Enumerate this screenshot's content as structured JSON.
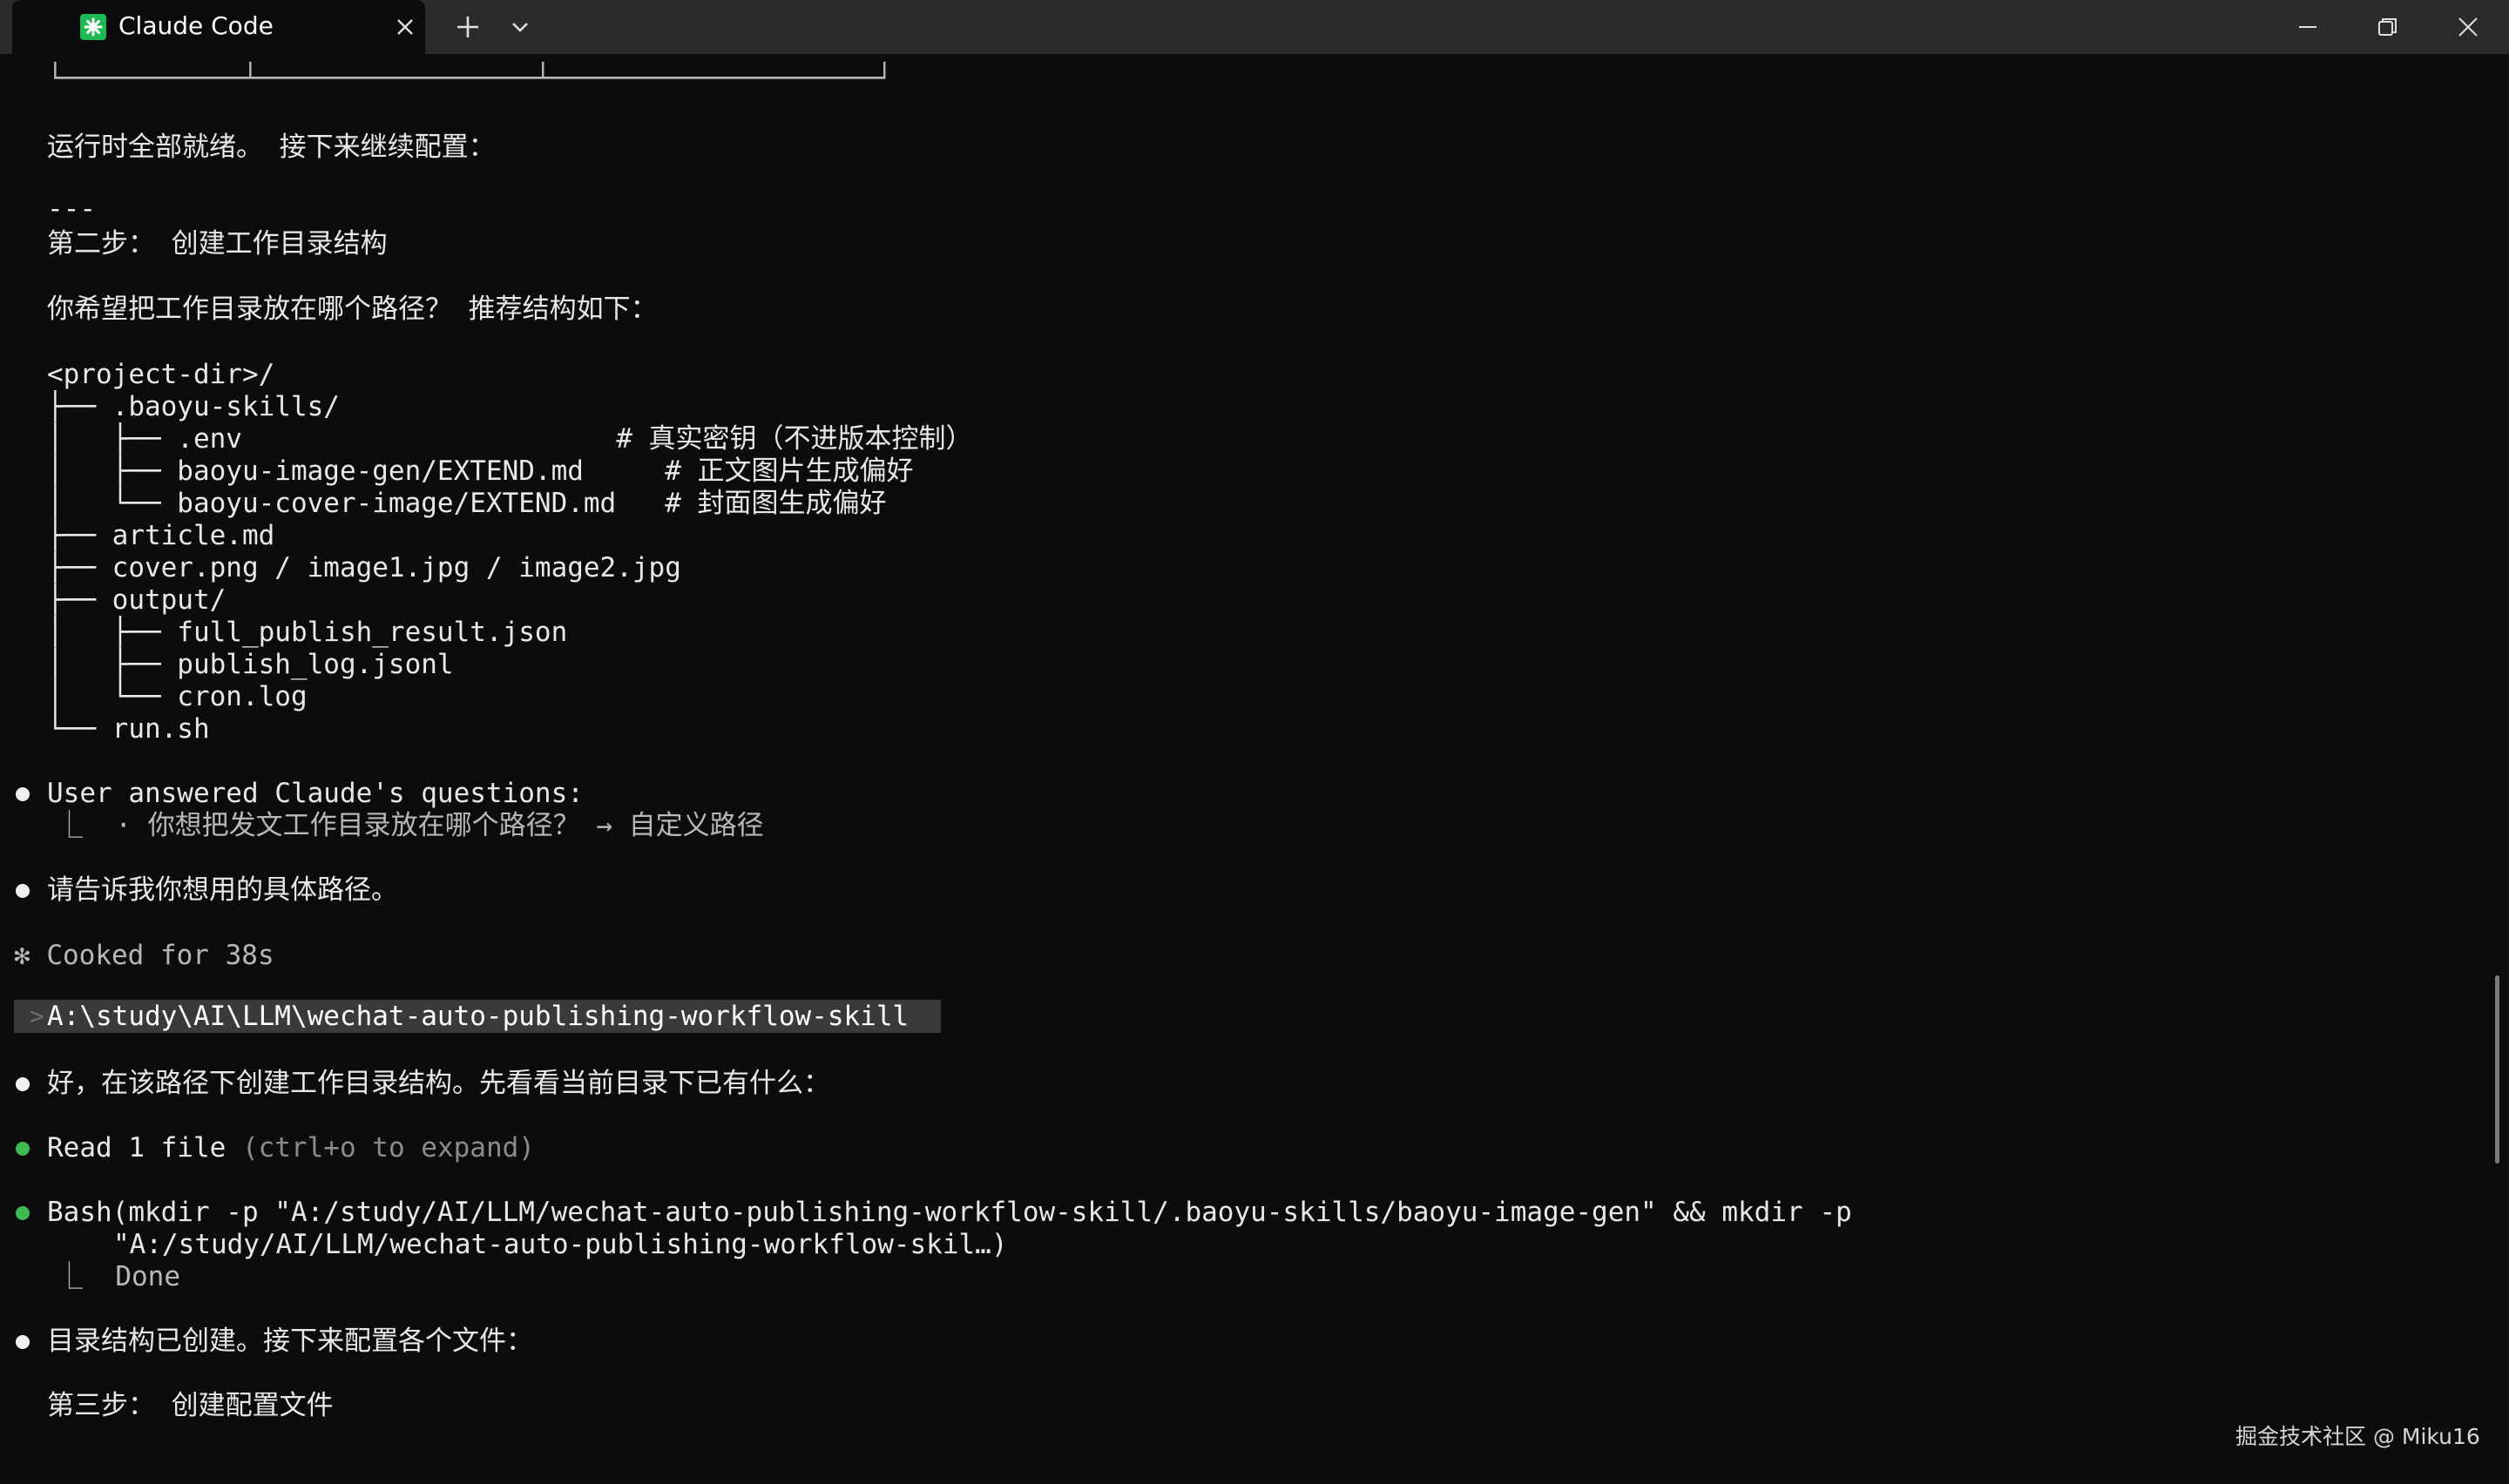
{
  "window": {
    "tab_title": "Claude Code",
    "icons": {
      "shell": "powershell-icon",
      "tab": "claude-asterisk-icon",
      "close": "close-icon",
      "new_tab": "plus-icon",
      "dropdown": "chevron-down-icon",
      "minimize": "minimize-icon",
      "restore": "restore-icon",
      "window_close": "close-icon"
    },
    "colors": {
      "titlebar": "#2b2b2b",
      "terminal_bg": "#0c0c0c",
      "tab_icon": "#1db954"
    }
  },
  "terminal": {
    "table_bottom_border": "└───────────┴─────────────────┴────────────────────┘",
    "runtime_ready": "运行时全部就绪。 接下来继续配置：",
    "separator": "---",
    "step2_title": "第二步： 创建工作目录结构",
    "question": "你希望把工作目录放在哪个路径？ 推荐结构如下：",
    "tree": [
      "<project-dir>/",
      "├── .baoyu-skills/",
      "│   ├── .env                       # 真实密钥（不进版本控制）",
      "│   ├── baoyu-image-gen/EXTEND.md     # 正文图片生成偏好",
      "│   └── baoyu-cover-image/EXTEND.md   # 封面图生成偏好",
      "├── article.md",
      "├── cover.png / image1.jpg / image2.jpg",
      "├── output/",
      "│   ├── full_publish_result.json",
      "│   ├── publish_log.jsonl",
      "│   └── cron.log",
      "└── run.sh"
    ],
    "user_answered": "User answered Claude's questions:",
    "user_answer_detail": "⎿  · 你想把发文工作目录放在哪个路径？ → 自定义路径",
    "ask_path": "请告诉我你想用的具体路径。",
    "cooked": "✻ Cooked for 38s",
    "prompt_caret": ">",
    "prompt_input": "A:\\study\\AI\\LLM\\wechat-auto-publishing-workflow-skill",
    "ok_create": "好，在该路径下创建工作目录结构。先看看当前目录下已有什么：",
    "read_label": "Read 1 file",
    "read_hint": "(ctrl+o to expand)",
    "bash_label": "Bash",
    "bash_cmd_line1": "(mkdir -p \"A:/study/AI/LLM/wechat-auto-publishing-workflow-skill/.baoyu-skills/baoyu-image-gen\" && mkdir -p",
    "bash_cmd_line2": "\"A:/study/AI/LLM/wechat-auto-publishing-workflow-skil…)",
    "bash_done": "⎿  Done",
    "dir_created": "目录结构已创建。接下来配置各个文件：",
    "step3_title": "第三步： 创建配置文件"
  },
  "watermark": "掘金技术社区 @ Miku16"
}
